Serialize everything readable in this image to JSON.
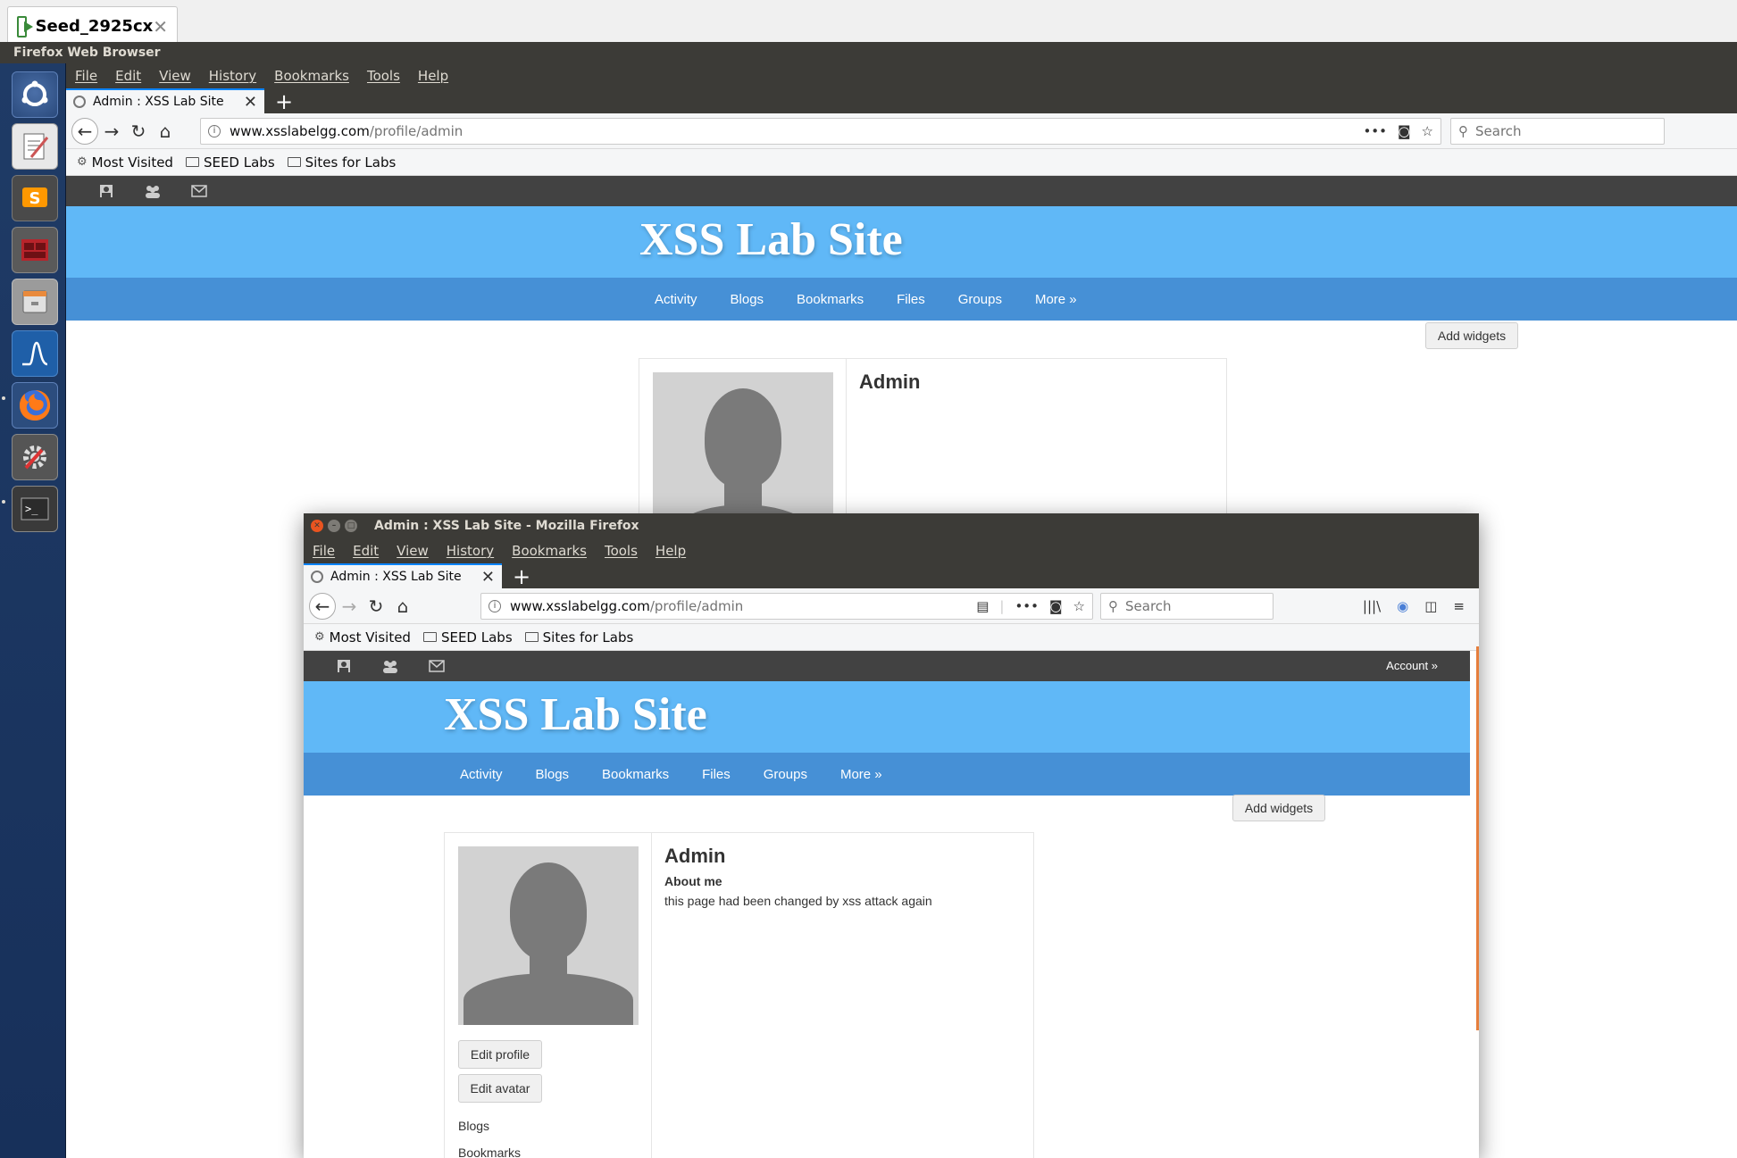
{
  "vm_tab": {
    "label": "Seed_2925cx",
    "close": "✕"
  },
  "unity_panel": {
    "title": "Firefox Web Browser"
  },
  "launcher": {
    "items": [
      "ubuntu-dash",
      "text-editor",
      "sublime-text",
      "terminal-emulator",
      "files",
      "wireshark",
      "firefox",
      "system-settings",
      "terminal"
    ]
  },
  "background_window": {
    "menu": [
      "File",
      "Edit",
      "View",
      "History",
      "Bookmarks",
      "Tools",
      "Help"
    ],
    "tab": {
      "label": "Admin : XSS Lab Site",
      "close": "✕",
      "new_tab": "+"
    },
    "url": {
      "host": "www.xsslabelgg.com",
      "path": "/profile/admin",
      "page_actions": "•••"
    },
    "search_placeholder": "Search",
    "bookmarks": [
      "Most Visited",
      "SEED Labs",
      "Sites for Labs"
    ],
    "site": {
      "title": "XSS Lab Site",
      "nav": [
        "Activity",
        "Blogs",
        "Bookmarks",
        "Files",
        "Groups",
        "More »"
      ],
      "add_widgets": "Add widgets",
      "profile_name": "Admin"
    }
  },
  "foreground_window": {
    "title": "Admin : XSS Lab Site - Mozilla Firefox",
    "menu": [
      "File",
      "Edit",
      "View",
      "History",
      "Bookmarks",
      "Tools",
      "Help"
    ],
    "tab": {
      "label": "Admin : XSS Lab Site",
      "close": "✕",
      "new_tab": "+"
    },
    "url": {
      "host": "www.xsslabelgg.com",
      "path": "/profile/admin",
      "page_actions": "•••"
    },
    "search_placeholder": "Search",
    "bookmarks": [
      "Most Visited",
      "SEED Labs",
      "Sites for Labs"
    ],
    "site": {
      "account": "Account »",
      "title": "XSS Lab Site",
      "nav": [
        "Activity",
        "Blogs",
        "Bookmarks",
        "Files",
        "Groups",
        "More »"
      ],
      "add_widgets": "Add widgets",
      "profile": {
        "name": "Admin",
        "about_heading": "About me",
        "about_text": "this page had been changed by xss attack again",
        "edit_profile": "Edit profile",
        "edit_avatar": "Edit avatar",
        "links": [
          "Blogs",
          "Bookmarks"
        ]
      }
    }
  },
  "colors": {
    "header_blue": "#60b8f7",
    "nav_blue": "#4690d6",
    "topbar_dark": "#424242",
    "ubuntu_panel": "#3c3b37",
    "launcher_blue": "#1f3b66",
    "scroll_accent": "#e67e3c"
  }
}
